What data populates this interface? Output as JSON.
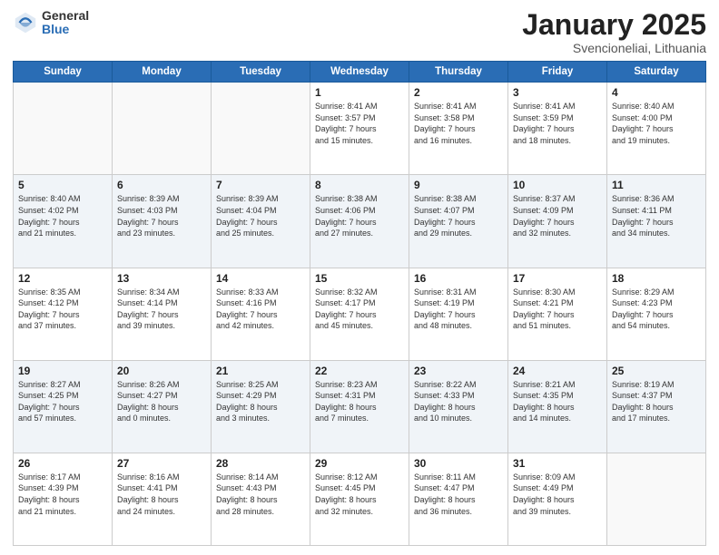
{
  "logo": {
    "general": "General",
    "blue": "Blue"
  },
  "header": {
    "month": "January 2025",
    "location": "Svencioneliai, Lithuania"
  },
  "weekdays": [
    "Sunday",
    "Monday",
    "Tuesday",
    "Wednesday",
    "Thursday",
    "Friday",
    "Saturday"
  ],
  "weeks": [
    [
      {
        "day": "",
        "info": ""
      },
      {
        "day": "",
        "info": ""
      },
      {
        "day": "",
        "info": ""
      },
      {
        "day": "1",
        "info": "Sunrise: 8:41 AM\nSunset: 3:57 PM\nDaylight: 7 hours\nand 15 minutes."
      },
      {
        "day": "2",
        "info": "Sunrise: 8:41 AM\nSunset: 3:58 PM\nDaylight: 7 hours\nand 16 minutes."
      },
      {
        "day": "3",
        "info": "Sunrise: 8:41 AM\nSunset: 3:59 PM\nDaylight: 7 hours\nand 18 minutes."
      },
      {
        "day": "4",
        "info": "Sunrise: 8:40 AM\nSunset: 4:00 PM\nDaylight: 7 hours\nand 19 minutes."
      }
    ],
    [
      {
        "day": "5",
        "info": "Sunrise: 8:40 AM\nSunset: 4:02 PM\nDaylight: 7 hours\nand 21 minutes."
      },
      {
        "day": "6",
        "info": "Sunrise: 8:39 AM\nSunset: 4:03 PM\nDaylight: 7 hours\nand 23 minutes."
      },
      {
        "day": "7",
        "info": "Sunrise: 8:39 AM\nSunset: 4:04 PM\nDaylight: 7 hours\nand 25 minutes."
      },
      {
        "day": "8",
        "info": "Sunrise: 8:38 AM\nSunset: 4:06 PM\nDaylight: 7 hours\nand 27 minutes."
      },
      {
        "day": "9",
        "info": "Sunrise: 8:38 AM\nSunset: 4:07 PM\nDaylight: 7 hours\nand 29 minutes."
      },
      {
        "day": "10",
        "info": "Sunrise: 8:37 AM\nSunset: 4:09 PM\nDaylight: 7 hours\nand 32 minutes."
      },
      {
        "day": "11",
        "info": "Sunrise: 8:36 AM\nSunset: 4:11 PM\nDaylight: 7 hours\nand 34 minutes."
      }
    ],
    [
      {
        "day": "12",
        "info": "Sunrise: 8:35 AM\nSunset: 4:12 PM\nDaylight: 7 hours\nand 37 minutes."
      },
      {
        "day": "13",
        "info": "Sunrise: 8:34 AM\nSunset: 4:14 PM\nDaylight: 7 hours\nand 39 minutes."
      },
      {
        "day": "14",
        "info": "Sunrise: 8:33 AM\nSunset: 4:16 PM\nDaylight: 7 hours\nand 42 minutes."
      },
      {
        "day": "15",
        "info": "Sunrise: 8:32 AM\nSunset: 4:17 PM\nDaylight: 7 hours\nand 45 minutes."
      },
      {
        "day": "16",
        "info": "Sunrise: 8:31 AM\nSunset: 4:19 PM\nDaylight: 7 hours\nand 48 minutes."
      },
      {
        "day": "17",
        "info": "Sunrise: 8:30 AM\nSunset: 4:21 PM\nDaylight: 7 hours\nand 51 minutes."
      },
      {
        "day": "18",
        "info": "Sunrise: 8:29 AM\nSunset: 4:23 PM\nDaylight: 7 hours\nand 54 minutes."
      }
    ],
    [
      {
        "day": "19",
        "info": "Sunrise: 8:27 AM\nSunset: 4:25 PM\nDaylight: 7 hours\nand 57 minutes."
      },
      {
        "day": "20",
        "info": "Sunrise: 8:26 AM\nSunset: 4:27 PM\nDaylight: 8 hours\nand 0 minutes."
      },
      {
        "day": "21",
        "info": "Sunrise: 8:25 AM\nSunset: 4:29 PM\nDaylight: 8 hours\nand 3 minutes."
      },
      {
        "day": "22",
        "info": "Sunrise: 8:23 AM\nSunset: 4:31 PM\nDaylight: 8 hours\nand 7 minutes."
      },
      {
        "day": "23",
        "info": "Sunrise: 8:22 AM\nSunset: 4:33 PM\nDaylight: 8 hours\nand 10 minutes."
      },
      {
        "day": "24",
        "info": "Sunrise: 8:21 AM\nSunset: 4:35 PM\nDaylight: 8 hours\nand 14 minutes."
      },
      {
        "day": "25",
        "info": "Sunrise: 8:19 AM\nSunset: 4:37 PM\nDaylight: 8 hours\nand 17 minutes."
      }
    ],
    [
      {
        "day": "26",
        "info": "Sunrise: 8:17 AM\nSunset: 4:39 PM\nDaylight: 8 hours\nand 21 minutes."
      },
      {
        "day": "27",
        "info": "Sunrise: 8:16 AM\nSunset: 4:41 PM\nDaylight: 8 hours\nand 24 minutes."
      },
      {
        "day": "28",
        "info": "Sunrise: 8:14 AM\nSunset: 4:43 PM\nDaylight: 8 hours\nand 28 minutes."
      },
      {
        "day": "29",
        "info": "Sunrise: 8:12 AM\nSunset: 4:45 PM\nDaylight: 8 hours\nand 32 minutes."
      },
      {
        "day": "30",
        "info": "Sunrise: 8:11 AM\nSunset: 4:47 PM\nDaylight: 8 hours\nand 36 minutes."
      },
      {
        "day": "31",
        "info": "Sunrise: 8:09 AM\nSunset: 4:49 PM\nDaylight: 8 hours\nand 39 minutes."
      },
      {
        "day": "",
        "info": ""
      }
    ]
  ]
}
